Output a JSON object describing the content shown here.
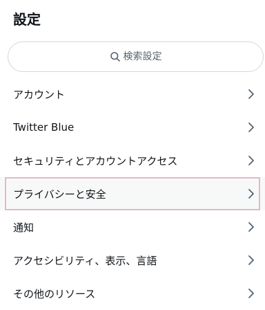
{
  "header": {
    "title": "設定"
  },
  "search": {
    "placeholder": "検索設定",
    "icon": "search-icon"
  },
  "menu": {
    "items": [
      {
        "label": "アカウント",
        "icon": "chevron-right-icon",
        "selected": false
      },
      {
        "label": "Twitter Blue",
        "icon": "chevron-right-icon",
        "selected": false
      },
      {
        "label": "セキュリティとアカウントアクセス",
        "icon": "chevron-right-icon",
        "selected": false
      },
      {
        "label": "プライバシーと安全",
        "icon": "chevron-right-icon",
        "selected": true
      },
      {
        "label": "通知",
        "icon": "chevron-right-icon",
        "selected": false
      },
      {
        "label": "アクセシビリティ、表示、言語",
        "icon": "chevron-right-icon",
        "selected": false
      },
      {
        "label": "その他のリソース",
        "icon": "chevron-right-icon",
        "selected": false
      }
    ]
  },
  "colors": {
    "text": "#0f1419",
    "muted": "#536471",
    "border": "#cfd9de",
    "selected_bg": "#f7f9f9",
    "selected_outline": "#e7b6c8"
  }
}
